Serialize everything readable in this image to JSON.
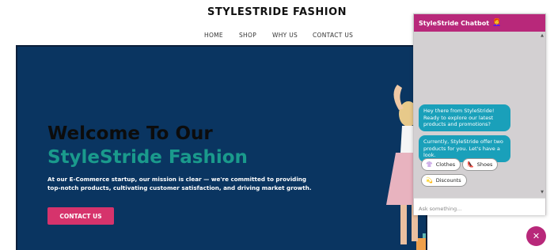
{
  "site": {
    "title": "STYLESTRIDE FASHION"
  },
  "nav": {
    "items": [
      "HOME",
      "SHOP",
      "WHY US",
      "CONTACT US"
    ]
  },
  "hero": {
    "title_line1": "Welcome To Our",
    "title_line2": "StyleStride Fashion",
    "text": "At our E-Commerce startup, our mission is clear — we're committed to providing top-notch products, cultivating customer satisfaction, and driving market growth.",
    "cta_label": "CONTACT US",
    "colors": {
      "background": "#0a3561",
      "accent_teal": "#1a9a8c",
      "accent_pink": "#d6336c"
    }
  },
  "chatbot": {
    "title": "StyleStride Chatbot",
    "title_icon": "👩‍🦰",
    "messages": [
      "Hey there from StyleStride! Ready to explore our latest products and promotions?",
      "Currently, StyleStride offer two products for you. Let's have a look."
    ],
    "options": [
      {
        "label": "Clothes",
        "icon": "clothes-icon",
        "glyph": "👚"
      },
      {
        "label": "Shoes",
        "icon": "shoe-icon",
        "glyph": "👠"
      },
      {
        "label": "Discounts",
        "icon": "discount-icon",
        "glyph": "💫"
      }
    ],
    "input_placeholder": "Ask something...",
    "colors": {
      "header": "#b8287a",
      "bubble": "#1aa0ba"
    }
  },
  "fab": {
    "close_glyph": "✕"
  }
}
